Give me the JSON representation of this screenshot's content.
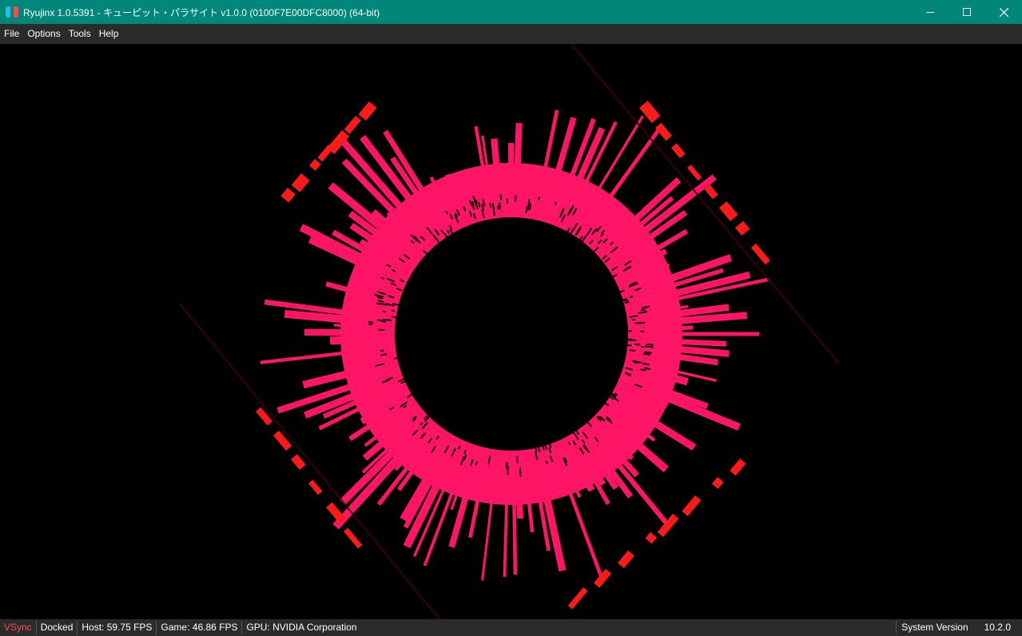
{
  "window": {
    "title": "Ryujinx 1.0.5391 - キューピット・パラサイト v1.0.0 (0100F7E00DFC8000) (64-bit)",
    "icon": "ryujinx-logo-icon",
    "controls": [
      "minimize-icon",
      "maximize-icon",
      "close-icon"
    ]
  },
  "menu": {
    "items": [
      {
        "label": "File"
      },
      {
        "label": "Options"
      },
      {
        "label": "Tools"
      },
      {
        "label": "Help"
      }
    ]
  },
  "game_view": {
    "description_type": "game-render",
    "colors": {
      "ring": "#ff1466",
      "accent_red": "#ff1a1a",
      "background": "#000000"
    }
  },
  "status": {
    "vsync": "VSync",
    "dock_mode": "Docked",
    "host_fps": "Host: 59.75 FPS",
    "game_fps": "Game: 46.86 FPS",
    "gpu": "GPU:  NVIDIA Corporation",
    "system_version_label": "System Version",
    "system_version_value": "10.2.0"
  },
  "colors": {
    "titlebar": "#00877a",
    "menubar": "#2b2b2b",
    "statusbar": "#2b2b2b",
    "vsync": "#ff4a5a"
  }
}
